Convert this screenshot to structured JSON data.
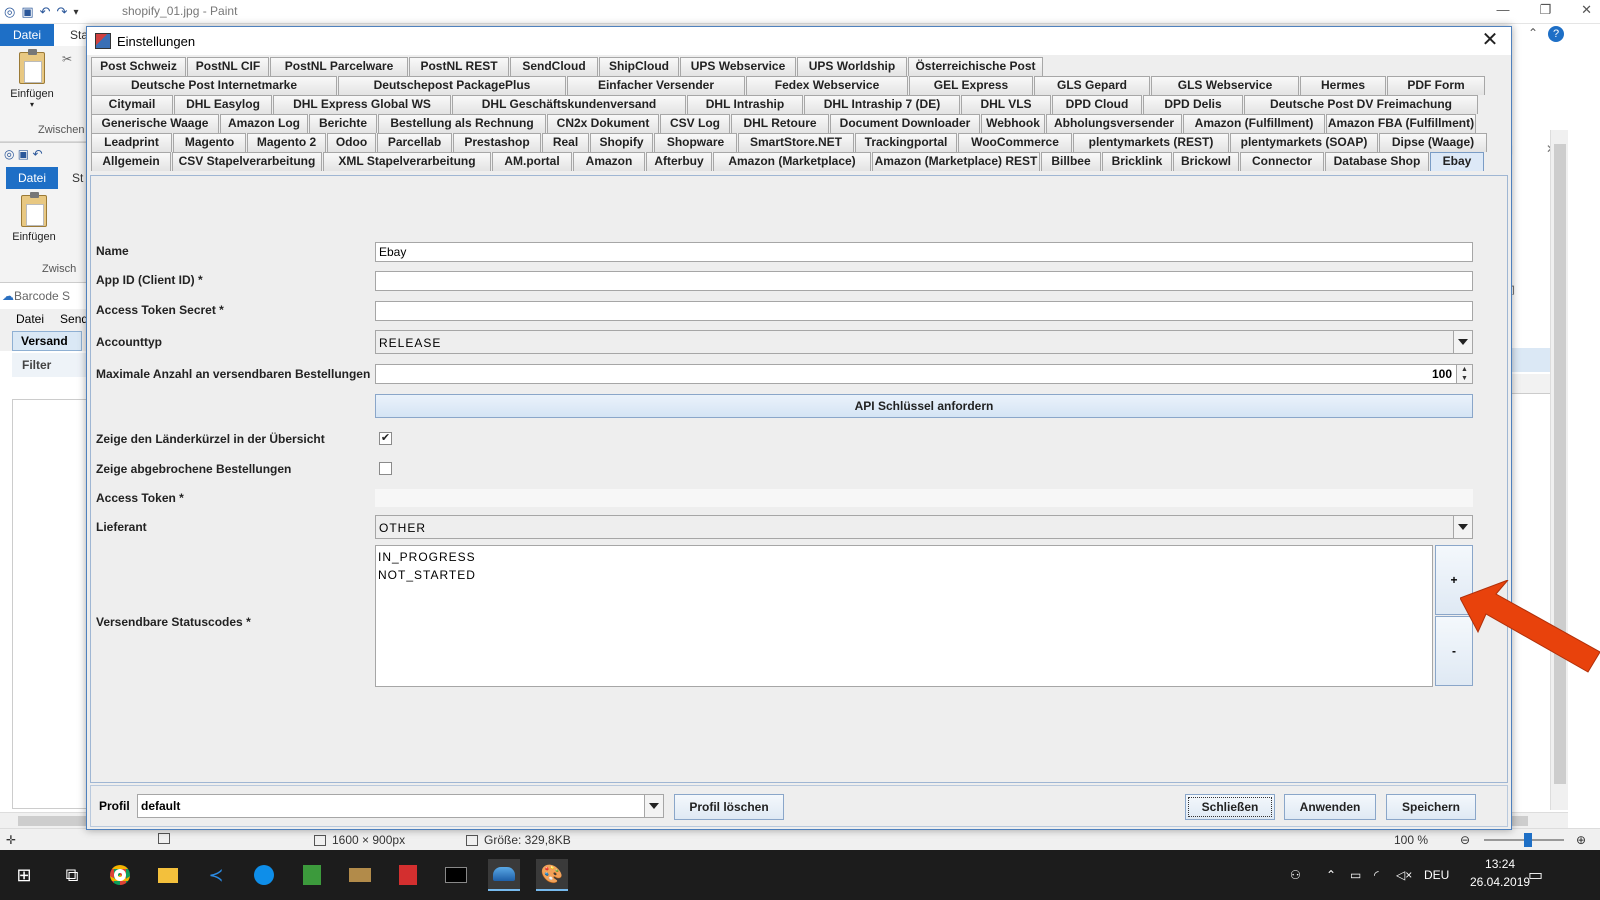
{
  "paint": {
    "title": "shopify_01.jpg - Paint",
    "tab_file": "Datei",
    "tab_start": "Sta",
    "paste_label": "Einfügen",
    "group_label": "Zwischen",
    "group_label2": "Zwisch",
    "tab_start2": "St",
    "barcode_title": "Barcode S",
    "barcode_menu": [
      "Datei",
      "Send"
    ],
    "barcode_tab": "Versand",
    "barcode_filter": "Filter",
    "right_col_partial": "n",
    "status_size": "1600 × 900px",
    "status_filesize": "Größe: 329,8KB",
    "zoom": "100 %"
  },
  "dialog": {
    "title": "Einstellungen",
    "tab_rows": [
      [
        "Post Schweiz",
        "PostNL CIF",
        "PostNL Parcelware",
        "PostNL REST",
        "SendCloud",
        "ShipCloud",
        "UPS Webservice",
        "UPS Worldship",
        "Österreichische Post"
      ],
      [
        "Deutsche Post Internetmarke",
        "Deutschepost PackagePlus",
        "Einfacher Versender",
        "Fedex Webservice",
        "GEL Express",
        "GLS Gepard",
        "GLS Webservice",
        "Hermes",
        "PDF Form"
      ],
      [
        "Citymail",
        "DHL Easylog",
        "DHL Express Global WS",
        "DHL Geschäftskundenversand",
        "DHL Intraship",
        "DHL Intraship 7 (DE)",
        "DHL VLS",
        "DPD Cloud",
        "DPD Delis",
        "Deutsche Post DV Freimachung"
      ],
      [
        "Generische Waage",
        "Amazon Log",
        "Berichte",
        "Bestellung als Rechnung",
        "CN2x Dokument",
        "CSV Log",
        "DHL Retoure",
        "Document Downloader",
        "Webhook",
        "Abholungsversender",
        "Amazon (Fulfillment)",
        "Amazon FBA (Fulfillment)"
      ],
      [
        "Leadprint",
        "Magento",
        "Magento 2",
        "Odoo",
        "Parcellab",
        "Prestashop",
        "Real",
        "Shopify",
        "Shopware",
        "SmartStore.NET",
        "Trackingportal",
        "WooCommerce",
        "plentymarkets (REST)",
        "plentymarkets (SOAP)",
        "Dipse (Waage)"
      ],
      [
        "Allgemein",
        "CSV Stapelverarbeitung",
        "XML Stapelverarbeitung",
        "AM.portal",
        "Amazon",
        "Afterbuy",
        "Amazon (Marketplace)",
        "Amazon (Marketplace) REST",
        "Billbee",
        "Bricklink",
        "Brickowl",
        "Connector",
        "Database Shop",
        "Ebay"
      ]
    ],
    "selected_tab": "Ebay",
    "form": {
      "name_label": "Name",
      "name_value": "Ebay",
      "appid_label": "App ID (Client ID) *",
      "appid_value": "",
      "secret_label": "Access Token Secret *",
      "secret_value": "",
      "accounttype_label": "Accounttyp",
      "accounttype_value": "RELEASE",
      "maxorders_label": "Maximale Anzahl an versendbaren Bestellungen",
      "maxorders_value": "100",
      "api_button": "API Schlüssel anfordern",
      "country_label": "Zeige den Länderkürzel in der Übersicht",
      "country_checked": true,
      "cancelled_label": "Zeige abgebrochene Bestellungen",
      "cancelled_checked": false,
      "token_label": "Access Token *",
      "supplier_label": "Lieferant",
      "supplier_value": "OTHER",
      "status_label": "Versendbare Statuscodes *",
      "status_codes": [
        "IN_PROGRESS",
        "NOT_STARTED"
      ],
      "add_label": "+",
      "remove_label": "-"
    },
    "profile": {
      "label": "Profil",
      "value": "default",
      "delete_button": "Profil löschen",
      "close_button": "Schließen",
      "apply_button": "Anwenden",
      "save_button": "Speichern"
    }
  },
  "taskbar": {
    "language": "DEU",
    "time": "13:24",
    "date": "26.04.2019"
  },
  "colors": {
    "accent": "#1e6fc6",
    "annotation_arrow": "#e8420c",
    "selected_tab": "#dde9f7"
  }
}
